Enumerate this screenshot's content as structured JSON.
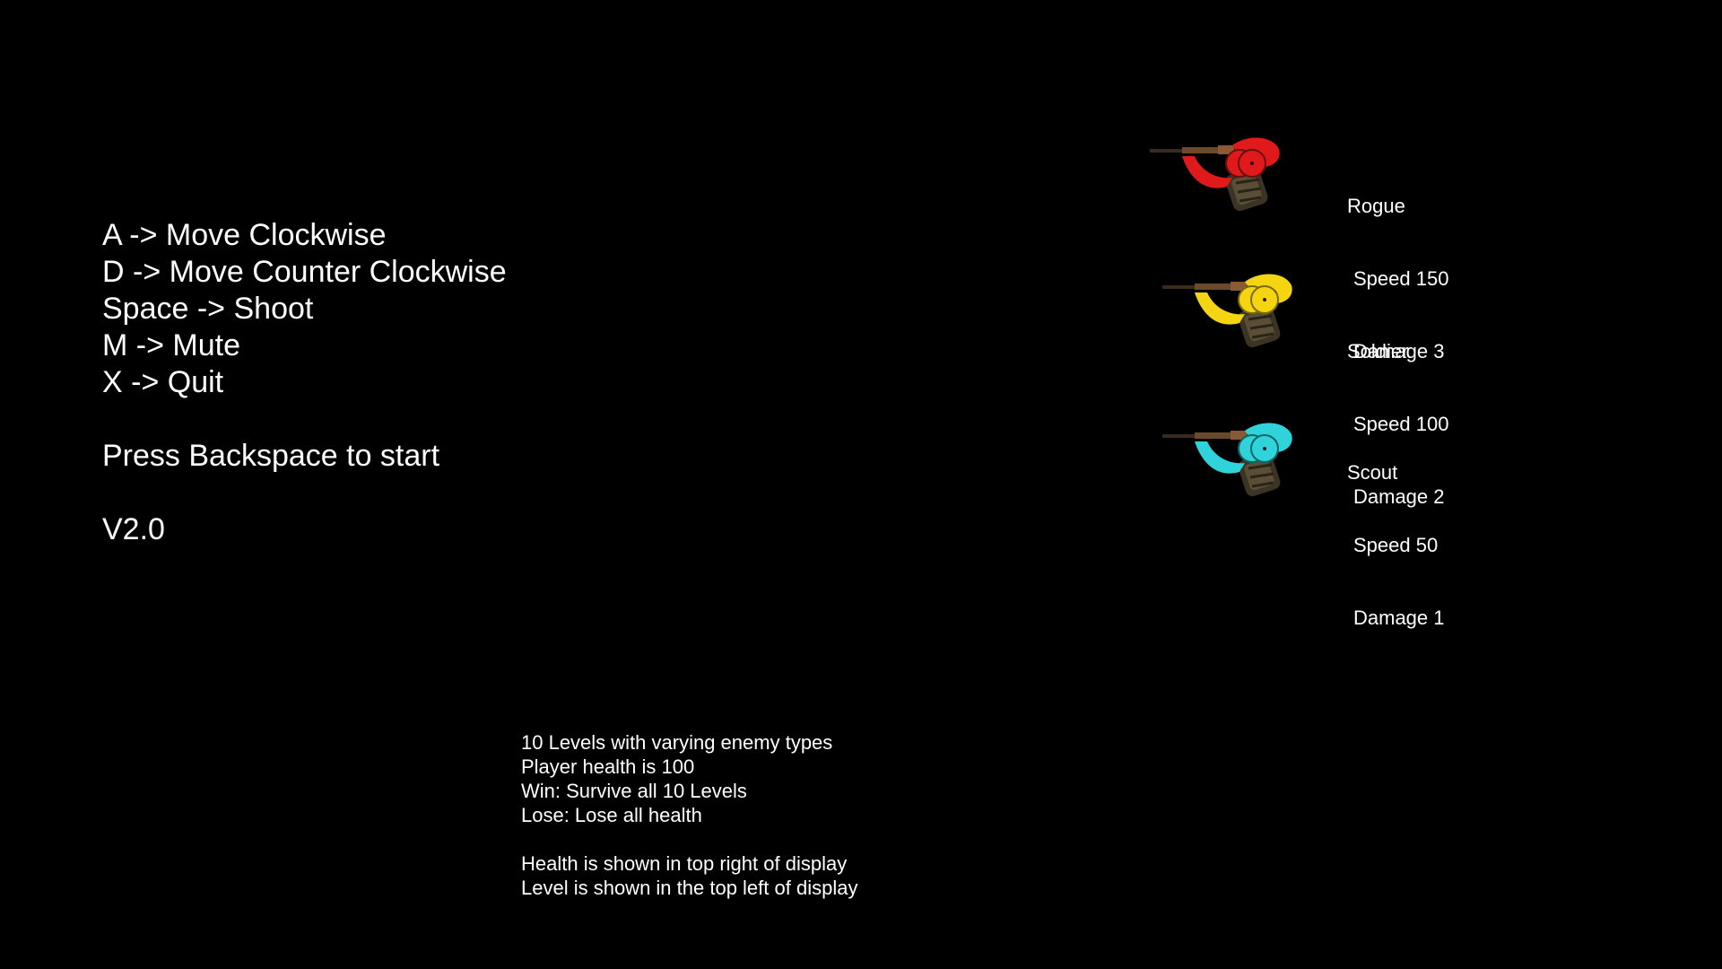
{
  "controls": {
    "lines": [
      "A -> Move Clockwise",
      "D -> Move Counter Clockwise",
      "Space -> Shoot",
      "M -> Mute",
      "X -> Quit"
    ],
    "start_prompt": "Press Backspace to start",
    "version": "V2.0"
  },
  "enemies": [
    {
      "name": "Rogue",
      "speed": "Speed 150",
      "damage": "Damage 3",
      "color": "#e01a1a",
      "icon": "rogue-enemy-icon"
    },
    {
      "name": "Soldier",
      "speed": "Speed 100",
      "damage": "Damage 2",
      "color": "#f5d511",
      "icon": "soldier-enemy-icon"
    },
    {
      "name": "Scout",
      "speed": "Speed 50",
      "damage": "Damage 1",
      "color": "#2fd3d9",
      "icon": "scout-enemy-icon"
    }
  ],
  "info": {
    "rules": [
      "10 Levels with varying enemy types",
      "Player health is 100",
      "Win: Survive all 10 Levels",
      "Lose: Lose all health"
    ],
    "hud": [
      "Health is shown in top right of display",
      "Level is shown in the top left of display"
    ]
  }
}
